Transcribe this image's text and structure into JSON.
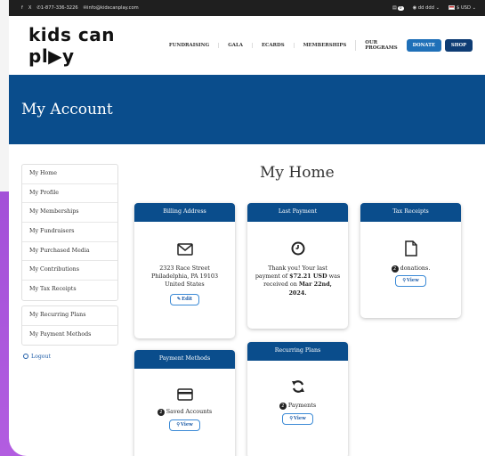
{
  "topbar": {
    "facebook_icon": "f",
    "x_icon": "X",
    "phone": "1-877-336-3226",
    "email": "info@kidscanplay.com",
    "cart_count": "0",
    "user_name": "dd ddd",
    "currency": "$ USD"
  },
  "header": {
    "logo_text": "kids can pl▶y",
    "nav": [
      "FUNDRAISING",
      "GALA",
      "ECARDS",
      "MEMBERSHIPS",
      "OUR PROGRAMS"
    ],
    "donate_label": "DONATE",
    "shop_label": "SHOP"
  },
  "banner": {
    "title": "My Account"
  },
  "sidebar": {
    "group1": [
      "My Home",
      "My Profile",
      "My Memberships",
      "My Fundraisers",
      "My Purchased Media",
      "My Contributions",
      "My Tax Receipts"
    ],
    "group2": [
      "My Recurring Plans",
      "My Payment Methods"
    ],
    "logout": "Logout"
  },
  "main": {
    "title": "My Home",
    "billing": {
      "title": "Billing Address",
      "line1": "2323 Race Street",
      "line2": "Philadelphia, PA 19103",
      "line3": "United States",
      "edit_label": "Edit"
    },
    "last_payment": {
      "title": "Last Payment",
      "text1": "Thank you! Your last",
      "text2a": "payment of ",
      "amount": "$72.21 USD",
      "text2b": " was",
      "text3a": "received on ",
      "date1": "Mar 22nd,",
      "date2": "2024."
    },
    "tax": {
      "title": "Tax Receipts",
      "count": "2",
      "text": "donations.",
      "view_label": "View"
    },
    "payment_methods": {
      "title": "Payment Methods",
      "count": "2",
      "text": "Saved Accounts",
      "view_label": "View"
    },
    "recurring": {
      "title": "Recurring Plans",
      "count": "2",
      "text": "Payments",
      "view_label": "View"
    }
  },
  "colors": {
    "primary": "#0a4d8c",
    "accent": "#1f70b8",
    "background": "#8a3fc8"
  }
}
